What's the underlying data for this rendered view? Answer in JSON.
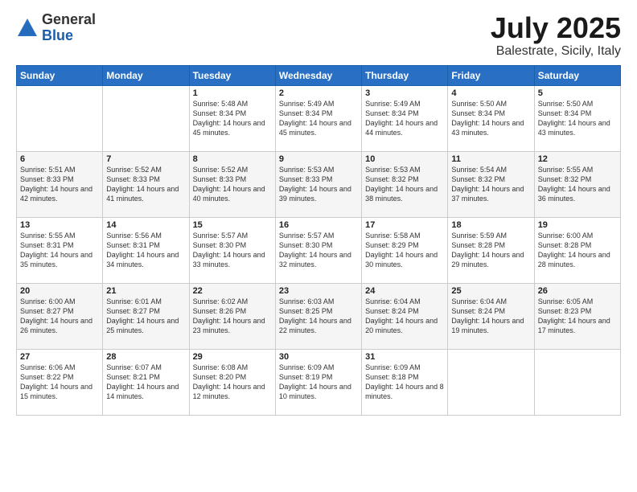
{
  "header": {
    "logo_general": "General",
    "logo_blue": "Blue",
    "month_year": "July 2025",
    "location": "Balestrate, Sicily, Italy"
  },
  "weekdays": [
    "Sunday",
    "Monday",
    "Tuesday",
    "Wednesday",
    "Thursday",
    "Friday",
    "Saturday"
  ],
  "weeks": [
    [
      {
        "day": "",
        "text": ""
      },
      {
        "day": "",
        "text": ""
      },
      {
        "day": "1",
        "text": "Sunrise: 5:48 AM\nSunset: 8:34 PM\nDaylight: 14 hours and 45 minutes."
      },
      {
        "day": "2",
        "text": "Sunrise: 5:49 AM\nSunset: 8:34 PM\nDaylight: 14 hours and 45 minutes."
      },
      {
        "day": "3",
        "text": "Sunrise: 5:49 AM\nSunset: 8:34 PM\nDaylight: 14 hours and 44 minutes."
      },
      {
        "day": "4",
        "text": "Sunrise: 5:50 AM\nSunset: 8:34 PM\nDaylight: 14 hours and 43 minutes."
      },
      {
        "day": "5",
        "text": "Sunrise: 5:50 AM\nSunset: 8:34 PM\nDaylight: 14 hours and 43 minutes."
      }
    ],
    [
      {
        "day": "6",
        "text": "Sunrise: 5:51 AM\nSunset: 8:33 PM\nDaylight: 14 hours and 42 minutes."
      },
      {
        "day": "7",
        "text": "Sunrise: 5:52 AM\nSunset: 8:33 PM\nDaylight: 14 hours and 41 minutes."
      },
      {
        "day": "8",
        "text": "Sunrise: 5:52 AM\nSunset: 8:33 PM\nDaylight: 14 hours and 40 minutes."
      },
      {
        "day": "9",
        "text": "Sunrise: 5:53 AM\nSunset: 8:33 PM\nDaylight: 14 hours and 39 minutes."
      },
      {
        "day": "10",
        "text": "Sunrise: 5:53 AM\nSunset: 8:32 PM\nDaylight: 14 hours and 38 minutes."
      },
      {
        "day": "11",
        "text": "Sunrise: 5:54 AM\nSunset: 8:32 PM\nDaylight: 14 hours and 37 minutes."
      },
      {
        "day": "12",
        "text": "Sunrise: 5:55 AM\nSunset: 8:32 PM\nDaylight: 14 hours and 36 minutes."
      }
    ],
    [
      {
        "day": "13",
        "text": "Sunrise: 5:55 AM\nSunset: 8:31 PM\nDaylight: 14 hours and 35 minutes."
      },
      {
        "day": "14",
        "text": "Sunrise: 5:56 AM\nSunset: 8:31 PM\nDaylight: 14 hours and 34 minutes."
      },
      {
        "day": "15",
        "text": "Sunrise: 5:57 AM\nSunset: 8:30 PM\nDaylight: 14 hours and 33 minutes."
      },
      {
        "day": "16",
        "text": "Sunrise: 5:57 AM\nSunset: 8:30 PM\nDaylight: 14 hours and 32 minutes."
      },
      {
        "day": "17",
        "text": "Sunrise: 5:58 AM\nSunset: 8:29 PM\nDaylight: 14 hours and 30 minutes."
      },
      {
        "day": "18",
        "text": "Sunrise: 5:59 AM\nSunset: 8:28 PM\nDaylight: 14 hours and 29 minutes."
      },
      {
        "day": "19",
        "text": "Sunrise: 6:00 AM\nSunset: 8:28 PM\nDaylight: 14 hours and 28 minutes."
      }
    ],
    [
      {
        "day": "20",
        "text": "Sunrise: 6:00 AM\nSunset: 8:27 PM\nDaylight: 14 hours and 26 minutes."
      },
      {
        "day": "21",
        "text": "Sunrise: 6:01 AM\nSunset: 8:27 PM\nDaylight: 14 hours and 25 minutes."
      },
      {
        "day": "22",
        "text": "Sunrise: 6:02 AM\nSunset: 8:26 PM\nDaylight: 14 hours and 23 minutes."
      },
      {
        "day": "23",
        "text": "Sunrise: 6:03 AM\nSunset: 8:25 PM\nDaylight: 14 hours and 22 minutes."
      },
      {
        "day": "24",
        "text": "Sunrise: 6:04 AM\nSunset: 8:24 PM\nDaylight: 14 hours and 20 minutes."
      },
      {
        "day": "25",
        "text": "Sunrise: 6:04 AM\nSunset: 8:24 PM\nDaylight: 14 hours and 19 minutes."
      },
      {
        "day": "26",
        "text": "Sunrise: 6:05 AM\nSunset: 8:23 PM\nDaylight: 14 hours and 17 minutes."
      }
    ],
    [
      {
        "day": "27",
        "text": "Sunrise: 6:06 AM\nSunset: 8:22 PM\nDaylight: 14 hours and 15 minutes."
      },
      {
        "day": "28",
        "text": "Sunrise: 6:07 AM\nSunset: 8:21 PM\nDaylight: 14 hours and 14 minutes."
      },
      {
        "day": "29",
        "text": "Sunrise: 6:08 AM\nSunset: 8:20 PM\nDaylight: 14 hours and 12 minutes."
      },
      {
        "day": "30",
        "text": "Sunrise: 6:09 AM\nSunset: 8:19 PM\nDaylight: 14 hours and 10 minutes."
      },
      {
        "day": "31",
        "text": "Sunrise: 6:09 AM\nSunset: 8:18 PM\nDaylight: 14 hours and 8 minutes."
      },
      {
        "day": "",
        "text": ""
      },
      {
        "day": "",
        "text": ""
      }
    ]
  ]
}
